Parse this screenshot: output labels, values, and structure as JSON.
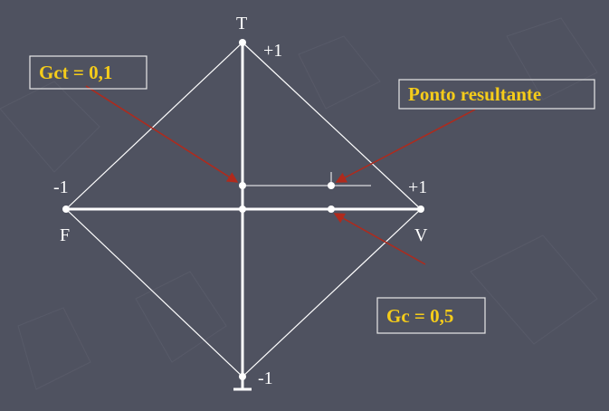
{
  "colors": {
    "background": "#4f5260",
    "lines": "#ffffff",
    "callout_text": "#f5cc1a",
    "arrows": "#b02a1c"
  },
  "axis_labels": {
    "top_letter": "T",
    "top_value": "+1",
    "left_value": "-1",
    "left_letter": "F",
    "right_value": "+1",
    "right_letter": "V",
    "bottom_value": "-1"
  },
  "callouts": {
    "gct": "Gct = 0,1",
    "resultant": "Ponto resultante",
    "gc": "Gc = 0,5"
  }
}
